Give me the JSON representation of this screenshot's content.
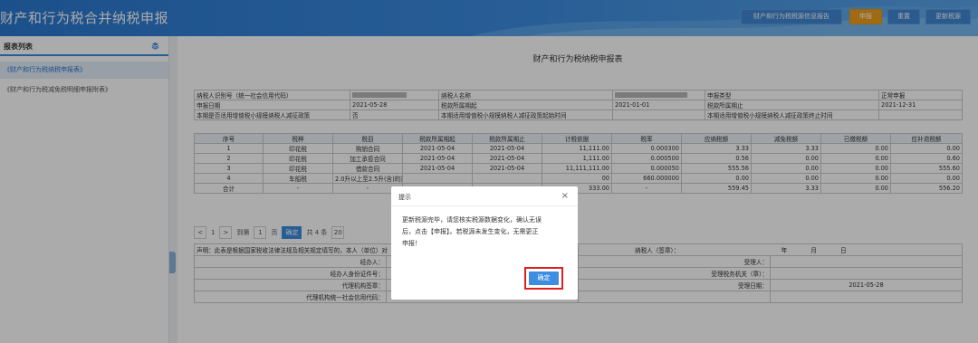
{
  "header": {
    "title": "财产和行为税合并纳税申报",
    "buttons": [
      "财产和行为税税源信息报告",
      "申报",
      "重置",
      "更新税源"
    ]
  },
  "sidebar": {
    "heading": "报表列表",
    "items": [
      "《财产和行为税纳税申报表》",
      "《财产和行为税减免税明细申报附表》"
    ]
  },
  "form": {
    "title": "财产和行为税纳税申报表",
    "info": {
      "row1": [
        "纳税人识别号（统一社会信用代码）",
        "纳税人名称",
        "申报类型",
        "正常申报"
      ],
      "row2": [
        "申报日期",
        "2021-05-28",
        "税款所属期起",
        "2021-01-01",
        "税款所属期止",
        "2021-12-31"
      ],
      "row3": [
        "本期是否适用增值税小规模纳税人减征政策",
        "否",
        "本期适用增值税小规模纳税人减征政策起始时间",
        "本期适用增值税小规模纳税人减征政策终止时间"
      ]
    },
    "columns": [
      "序号",
      "税种",
      "税目",
      "税款所属期起",
      "税款所属期止",
      "计税依据",
      "税率",
      "应纳税额",
      "减免税额",
      "已缴税额",
      "应补退税额"
    ],
    "rows": [
      [
        "1",
        "印花税",
        "购销合同",
        "2021-05-04",
        "2021-05-04",
        "11,111.00",
        "0.000300",
        "3.33",
        "3.33",
        "0.00",
        "0.00"
      ],
      [
        "2",
        "印花税",
        "加工承揽合同",
        "2021-05-04",
        "2021-05-04",
        "1,111.00",
        "0.000500",
        "0.56",
        "0.00",
        "0.00",
        "0.60"
      ],
      [
        "3",
        "印花税",
        "借款合同",
        "2021-05-04",
        "2021-05-04",
        "11,111,111.00",
        "0.000050",
        "555.56",
        "0.00",
        "0.00",
        "555.60"
      ],
      [
        "4",
        "车船税",
        "2.0升以上至2.5升(含)的乘用车",
        "",
        "",
        "00",
        "660.000000",
        "0.00",
        "0.00",
        "0.00",
        "0.00"
      ]
    ],
    "total": [
      "合计",
      "-",
      "-",
      "",
      "",
      "333.00",
      "-",
      "559.45",
      "3.33",
      "0.00",
      "556.20"
    ],
    "pager": {
      "prev": "<",
      "page": "1",
      "next": ">",
      "goto_label": "到第",
      "goto_value": "1",
      "page_unit": "页",
      "confirm": "确定",
      "total": "共 4 条",
      "size": "20"
    },
    "declaration": {
      "statement": "声明：此表是根据国家税收法律法规及相关规定填写的，本人（单位）对",
      "taxpayer_sign": "纳税人（签章）：",
      "year": "年",
      "month": "月",
      "day": "日",
      "agent": "经办人：",
      "agent_id": "经办人身份证件号：",
      "agency_sign": "代理机构签章：",
      "agency_code": "代理机构统一社会信用代码：",
      "receiver": "受理人：",
      "receiving_office": "受理税务机关（章）：",
      "receive_date_label": "受理日期：",
      "receive_date": "2021-05-28"
    }
  },
  "dialog": {
    "title": "提示",
    "close": "×",
    "message": "更新税源完毕，请您核实税源数据变化，确认无误\n后，点击【申报】。若税源未发生变化，无需更正\n申报！",
    "ok": "确定"
  }
}
